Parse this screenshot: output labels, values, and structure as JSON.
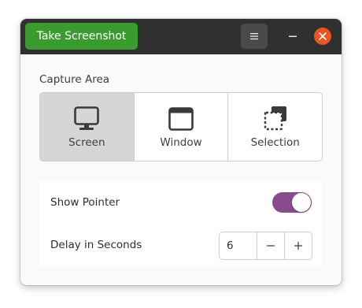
{
  "header": {
    "primary_action_label": "Take Screenshot",
    "menu_icon": "hamburger-menu-icon",
    "minimize_icon": "minimize-icon",
    "close_icon": "close-icon",
    "close_color": "#e95420",
    "primary_color": "#3a9b2e"
  },
  "capture_area": {
    "label": "Capture Area",
    "selected": "Screen",
    "options": [
      {
        "label": "Screen",
        "icon": "monitor-icon"
      },
      {
        "label": "Window",
        "icon": "window-icon"
      },
      {
        "label": "Selection",
        "icon": "selection-icon"
      }
    ]
  },
  "settings": {
    "show_pointer": {
      "label": "Show Pointer",
      "enabled": true,
      "accent_color": "#8a4b8e"
    },
    "delay": {
      "label": "Delay in Seconds",
      "value": "6",
      "decrement_icon": "minus-icon",
      "increment_icon": "plus-icon"
    }
  }
}
